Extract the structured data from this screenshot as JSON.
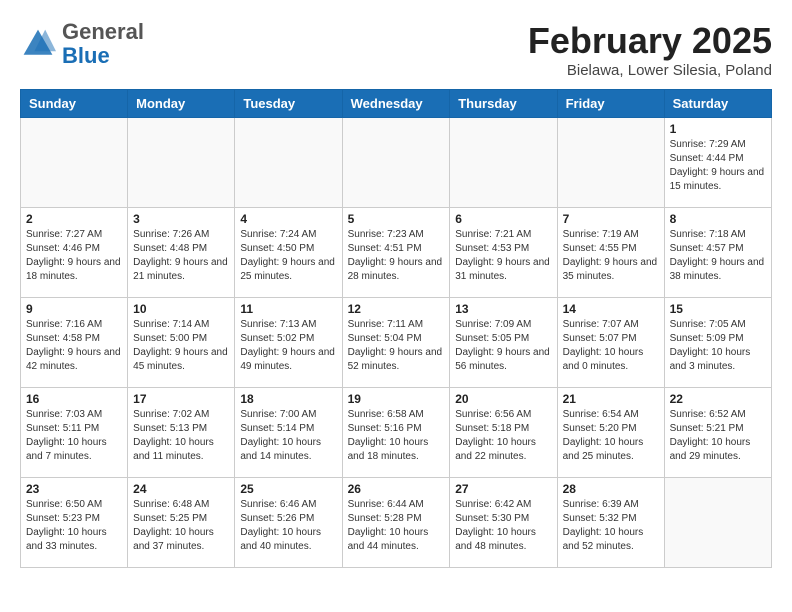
{
  "header": {
    "logo_general": "General",
    "logo_blue": "Blue",
    "month_title": "February 2025",
    "location": "Bielawa, Lower Silesia, Poland"
  },
  "days_of_week": [
    "Sunday",
    "Monday",
    "Tuesday",
    "Wednesday",
    "Thursday",
    "Friday",
    "Saturday"
  ],
  "weeks": [
    [
      {
        "day": "",
        "info": ""
      },
      {
        "day": "",
        "info": ""
      },
      {
        "day": "",
        "info": ""
      },
      {
        "day": "",
        "info": ""
      },
      {
        "day": "",
        "info": ""
      },
      {
        "day": "",
        "info": ""
      },
      {
        "day": "1",
        "info": "Sunrise: 7:29 AM\nSunset: 4:44 PM\nDaylight: 9 hours and 15 minutes."
      }
    ],
    [
      {
        "day": "2",
        "info": "Sunrise: 7:27 AM\nSunset: 4:46 PM\nDaylight: 9 hours and 18 minutes."
      },
      {
        "day": "3",
        "info": "Sunrise: 7:26 AM\nSunset: 4:48 PM\nDaylight: 9 hours and 21 minutes."
      },
      {
        "day": "4",
        "info": "Sunrise: 7:24 AM\nSunset: 4:50 PM\nDaylight: 9 hours and 25 minutes."
      },
      {
        "day": "5",
        "info": "Sunrise: 7:23 AM\nSunset: 4:51 PM\nDaylight: 9 hours and 28 minutes."
      },
      {
        "day": "6",
        "info": "Sunrise: 7:21 AM\nSunset: 4:53 PM\nDaylight: 9 hours and 31 minutes."
      },
      {
        "day": "7",
        "info": "Sunrise: 7:19 AM\nSunset: 4:55 PM\nDaylight: 9 hours and 35 minutes."
      },
      {
        "day": "8",
        "info": "Sunrise: 7:18 AM\nSunset: 4:57 PM\nDaylight: 9 hours and 38 minutes."
      }
    ],
    [
      {
        "day": "9",
        "info": "Sunrise: 7:16 AM\nSunset: 4:58 PM\nDaylight: 9 hours and 42 minutes."
      },
      {
        "day": "10",
        "info": "Sunrise: 7:14 AM\nSunset: 5:00 PM\nDaylight: 9 hours and 45 minutes."
      },
      {
        "day": "11",
        "info": "Sunrise: 7:13 AM\nSunset: 5:02 PM\nDaylight: 9 hours and 49 minutes."
      },
      {
        "day": "12",
        "info": "Sunrise: 7:11 AM\nSunset: 5:04 PM\nDaylight: 9 hours and 52 minutes."
      },
      {
        "day": "13",
        "info": "Sunrise: 7:09 AM\nSunset: 5:05 PM\nDaylight: 9 hours and 56 minutes."
      },
      {
        "day": "14",
        "info": "Sunrise: 7:07 AM\nSunset: 5:07 PM\nDaylight: 10 hours and 0 minutes."
      },
      {
        "day": "15",
        "info": "Sunrise: 7:05 AM\nSunset: 5:09 PM\nDaylight: 10 hours and 3 minutes."
      }
    ],
    [
      {
        "day": "16",
        "info": "Sunrise: 7:03 AM\nSunset: 5:11 PM\nDaylight: 10 hours and 7 minutes."
      },
      {
        "day": "17",
        "info": "Sunrise: 7:02 AM\nSunset: 5:13 PM\nDaylight: 10 hours and 11 minutes."
      },
      {
        "day": "18",
        "info": "Sunrise: 7:00 AM\nSunset: 5:14 PM\nDaylight: 10 hours and 14 minutes."
      },
      {
        "day": "19",
        "info": "Sunrise: 6:58 AM\nSunset: 5:16 PM\nDaylight: 10 hours and 18 minutes."
      },
      {
        "day": "20",
        "info": "Sunrise: 6:56 AM\nSunset: 5:18 PM\nDaylight: 10 hours and 22 minutes."
      },
      {
        "day": "21",
        "info": "Sunrise: 6:54 AM\nSunset: 5:20 PM\nDaylight: 10 hours and 25 minutes."
      },
      {
        "day": "22",
        "info": "Sunrise: 6:52 AM\nSunset: 5:21 PM\nDaylight: 10 hours and 29 minutes."
      }
    ],
    [
      {
        "day": "23",
        "info": "Sunrise: 6:50 AM\nSunset: 5:23 PM\nDaylight: 10 hours and 33 minutes."
      },
      {
        "day": "24",
        "info": "Sunrise: 6:48 AM\nSunset: 5:25 PM\nDaylight: 10 hours and 37 minutes."
      },
      {
        "day": "25",
        "info": "Sunrise: 6:46 AM\nSunset: 5:26 PM\nDaylight: 10 hours and 40 minutes."
      },
      {
        "day": "26",
        "info": "Sunrise: 6:44 AM\nSunset: 5:28 PM\nDaylight: 10 hours and 44 minutes."
      },
      {
        "day": "27",
        "info": "Sunrise: 6:42 AM\nSunset: 5:30 PM\nDaylight: 10 hours and 48 minutes."
      },
      {
        "day": "28",
        "info": "Sunrise: 6:39 AM\nSunset: 5:32 PM\nDaylight: 10 hours and 52 minutes."
      },
      {
        "day": "",
        "info": ""
      }
    ]
  ]
}
